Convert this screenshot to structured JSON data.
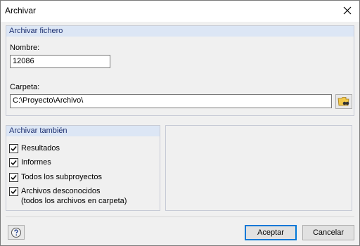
{
  "window": {
    "title": "Archivar"
  },
  "archivar_fichero": {
    "header": "Archivar fichero",
    "nombre_label": "Nombre:",
    "nombre_value": "12086",
    "carpeta_label": "Carpeta:",
    "carpeta_value": "C:\\Proyecto\\Archivo\\"
  },
  "archivar_tambien": {
    "header": "Archivar también",
    "items": [
      {
        "label": "Resultados",
        "checked": true
      },
      {
        "label": "Informes",
        "checked": true
      },
      {
        "label": "Todos los subproyectos",
        "checked": true
      },
      {
        "label": "Archivos desconocidos",
        "label2": "(todos los archivos en carpeta)",
        "checked": true
      }
    ]
  },
  "buttons": {
    "accept": "Aceptar",
    "cancel": "Cancelar"
  },
  "icons": {
    "close": "close-icon",
    "folder_browse": "folder-browse-icon",
    "help": "help-icon"
  }
}
